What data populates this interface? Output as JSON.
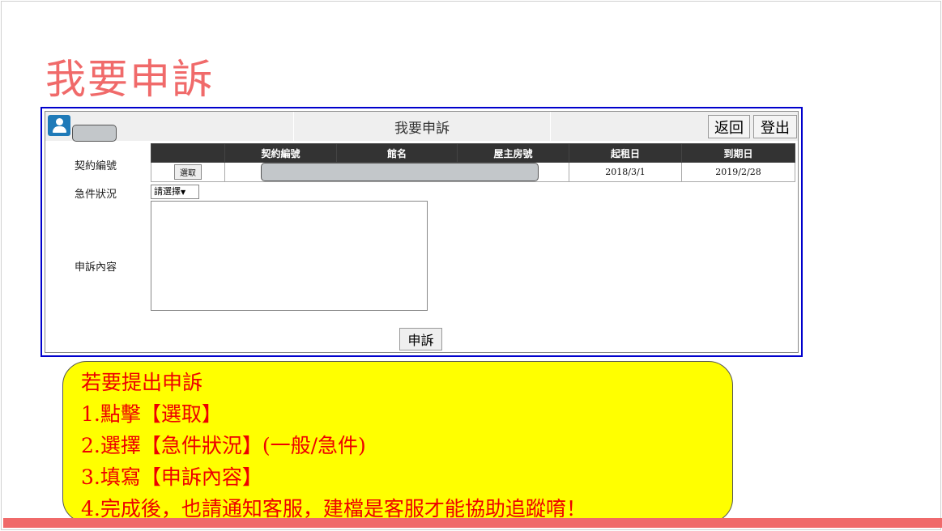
{
  "slide": {
    "title": "我要申訴"
  },
  "app": {
    "header_title": "我要申訴",
    "back_label": "返回",
    "logout_label": "登出",
    "labels": {
      "contract_no": "契約編號",
      "urgency": "急件狀況",
      "complaint_content": "申訴內容"
    },
    "table": {
      "headers": [
        "",
        "契約編號",
        "館名",
        "屋主房號",
        "起租日",
        "到期日"
      ],
      "row": {
        "select_label": "選取",
        "contract_no": "",
        "hall_name": "",
        "room_no": "",
        "start_date": "2018/3/1",
        "end_date": "2019/2/28"
      }
    },
    "urgency_select": {
      "selected": "請選擇"
    },
    "submit_label": "申訴"
  },
  "callout": {
    "lines": [
      "若要提出申訴",
      "1.點擊【選取】",
      "2.選擇【急件狀況】(一般/急件)",
      "3.填寫【申訴內容】",
      "4.完成後，也請通知客服，建檔是客服才能協助追蹤唷！"
    ],
    "background_color": "#ffff00",
    "text_color": "#ee0000"
  },
  "colors": {
    "title": "#f06a6a",
    "frame_border": "#0000cc",
    "bottom_bar": "#f06a6a"
  }
}
